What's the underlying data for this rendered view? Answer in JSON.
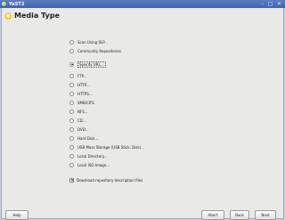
{
  "window": {
    "title": "YaST2",
    "minimize_glyph": "–",
    "maximize_glyph": "□",
    "close_glyph": "✕"
  },
  "page": {
    "title": "Media Type"
  },
  "options": [
    {
      "label": "Scan Using SLP...",
      "selected": false
    },
    {
      "label": "Community Repositories",
      "selected": false
    },
    {
      "label": "Specify URL...",
      "selected": true
    },
    {
      "label": "FTP...",
      "selected": false
    },
    {
      "label": "HTTP...",
      "selected": false
    },
    {
      "label": "HTTPS...",
      "selected": false
    },
    {
      "label": "SMB/CIFS",
      "selected": false
    },
    {
      "label": "NFS...",
      "selected": false
    },
    {
      "label": "CD...",
      "selected": false
    },
    {
      "label": "DVD...",
      "selected": false
    },
    {
      "label": "Hard Disk...",
      "selected": false
    },
    {
      "label": "USB Mass Storage (USB Stick, Disk)...",
      "selected": false
    },
    {
      "label": "Local Directory...",
      "selected": false
    },
    {
      "label": "Local ISO Image...",
      "selected": false
    }
  ],
  "download_checkbox": {
    "label": "Download repository description files",
    "checked": true,
    "mark": "✕"
  },
  "buttons": {
    "help": "Help",
    "abort": "Abort",
    "back": "Back",
    "next": "Next"
  }
}
